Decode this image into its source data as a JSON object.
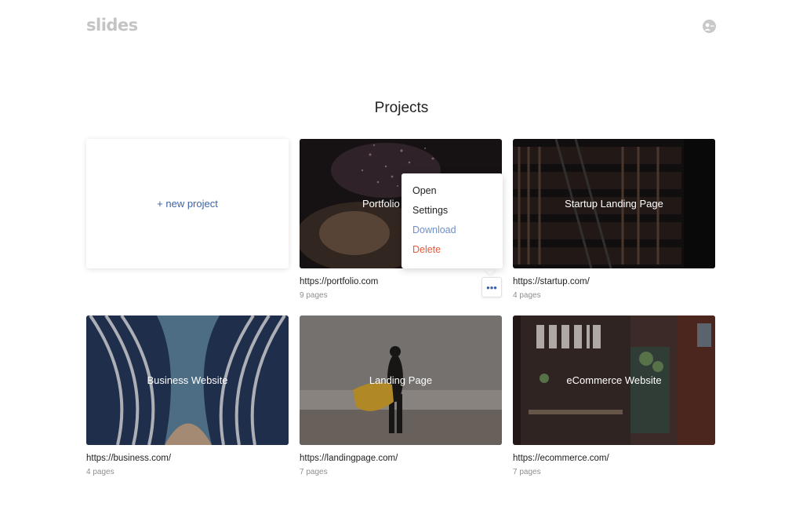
{
  "header": {
    "logo": "slides",
    "avatar_icon": "user-avatar-icon"
  },
  "page": {
    "title": "Projects"
  },
  "new_project": {
    "label": "+ new project"
  },
  "projects": [
    {
      "title": "Portfolio",
      "url": "https://portfolio.com",
      "pages": "9 pages"
    },
    {
      "title": "Startup Landing Page",
      "url": "https://startup.com/",
      "pages": "4 pages"
    },
    {
      "title": "Business Website",
      "url": "https://business.com/",
      "pages": "4 pages"
    },
    {
      "title": "Landing Page",
      "url": "https://landingpage.com/",
      "pages": "7 pages"
    },
    {
      "title": "eCommerce Website",
      "url": "https://ecommerce.com/",
      "pages": "7 pages"
    }
  ],
  "context_menu": {
    "open": "Open",
    "settings": "Settings",
    "download": "Download",
    "delete": "Delete"
  },
  "more_button": {
    "label": "•••"
  },
  "colors": {
    "accent": "#3b63a8",
    "download": "#6f8fc6",
    "delete": "#e05a3c"
  }
}
